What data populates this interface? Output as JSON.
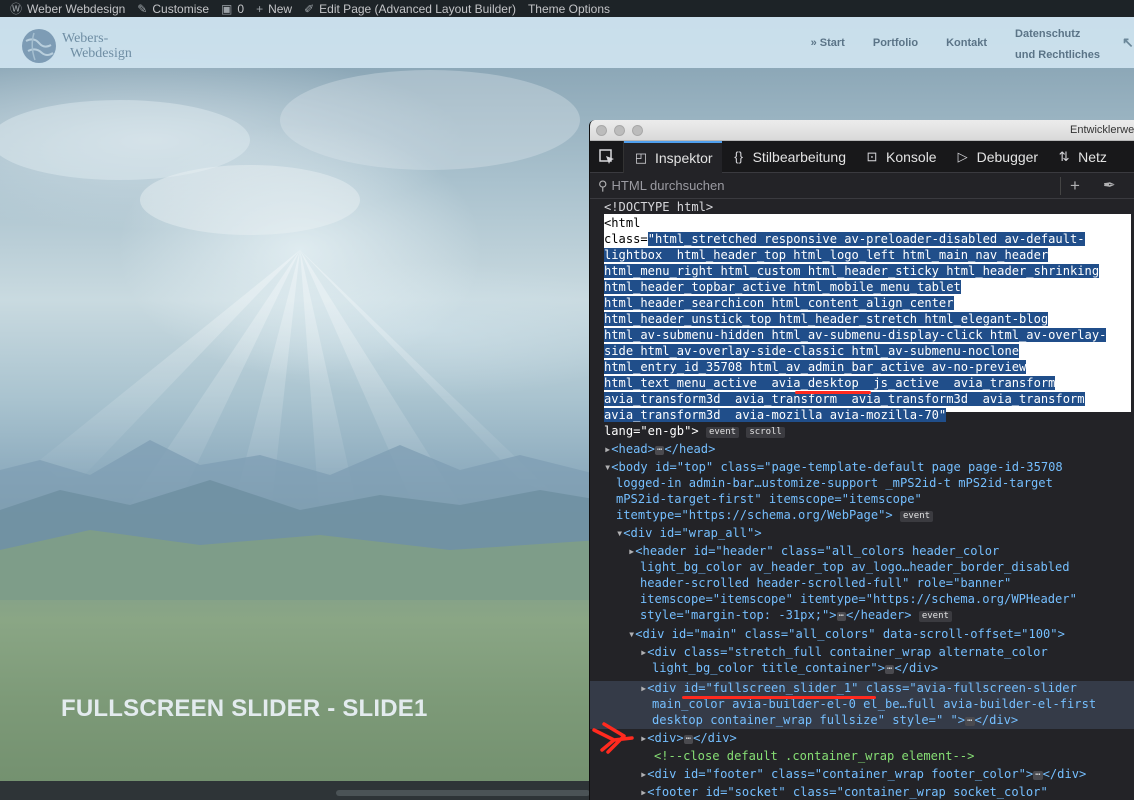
{
  "admin_bar": {
    "site_name": "Weber Webdesign",
    "customise": "Customise",
    "comments_count": "0",
    "new": "New",
    "edit_page": "Edit Page (Advanced Layout Builder)",
    "theme_options": "Theme Options",
    "icons": [
      "wordpress-icon",
      "home-icon",
      "brush-icon",
      "comment-icon",
      "plus-icon",
      "pencil-icon"
    ]
  },
  "site_header": {
    "logo_line1": "Webers-",
    "logo_line2": "Webdesign",
    "nav": {
      "start": "» Start",
      "portfolio": "Portfolio",
      "kontakt": "Kontakt",
      "datenschutz_line1": "Datenschutz",
      "datenschutz_line2": "und Rechtliches"
    }
  },
  "slide": {
    "caption": "FULLSCREEN SLIDER - SLIDE1"
  },
  "devtools": {
    "window_title": "Entwicklerwe",
    "tabs": {
      "inspector": "Inspektor",
      "style_editor": "Stilbearbeitung",
      "console": "Konsole",
      "debugger": "Debugger",
      "network": "Netz"
    },
    "search_placeholder": "HTML durchsuchen",
    "tree": {
      "doctype": "<!DOCTYPE html>",
      "html_open": "<html",
      "class_attr": "class=",
      "class_lines": [
        "\"html_stretched responsive av-preloader-disabled av-default-",
        "lightbox  html_header_top html_logo_left html_main_nav_header",
        "html_menu_right html_custom html_header_sticky html_header_shrinking",
        "html_header_topbar_active html_mobile_menu_tablet",
        "html_header_searchicon html_content_align_center",
        "html_header_unstick_top html_header_stretch html_elegant-blog",
        "html_av-submenu-hidden html_av-submenu-display-click html_av-overlay-",
        "side html_av-overlay-side-classic html_av-submenu-noclone",
        "html_entry_id_35708 html_av_admin_bar_active av-no-preview",
        "html_text_menu_active  avia_desktop  js_active  avia_transform",
        "avia_transform3d  avia_transform  avia_transform3d  avia_transform",
        "avia_transform3d  avia-mozilla avia-mozilla-70\""
      ],
      "lang_line": "lang=\"en-gb\">",
      "badge_event": "event",
      "badge_scroll": "scroll",
      "head": "<head>",
      "head_close": "</head>",
      "body_line1": "<body id=\"top\" class=\"page-template-default page page-id-35708",
      "body_line2": "logged-in admin-bar…ustomize-support _mPS2id-t mPS2id-target",
      "body_line3": "mPS2id-target-first\" itemscope=\"itemscope\"",
      "body_line4": "itemtype=\"https://schema.org/WebPage\">",
      "wrap_all": "<div id=\"wrap_all\">",
      "header_line1": "<header id=\"header\" class=\"all_colors header_color",
      "header_line2": "light_bg_color av_header_top av_logo…header_border_disabled",
      "header_line3": "header-scrolled header-scrolled-full\" role=\"banner\"",
      "header_line4": "itemscope=\"itemscope\" itemtype=\"https://schema.org/WPHeader\"",
      "header_line5": "style=\"margin-top: -31px;\">",
      "header_close": "</header>",
      "main_line": "<div id=\"main\" class=\"all_colors\" data-scroll-offset=\"100\">",
      "stretch_line1": "<div class=\"stretch_full container_wrap alternate_color",
      "stretch_line2": "light_bg_color title_container\">",
      "div_close": "</div>",
      "slider_line1": "<div id=\"fullscreen_slider_1\" class=\"avia-fullscreen-slider",
      "slider_line2": "main_color avia-builder-el-0 el_be…full avia-builder-el-first",
      "slider_line3": "desktop container_wrap fullsize\" style=\" \">",
      "plain_div": "<div>",
      "comment": "<!--close default .container_wrap element-->",
      "footer_line": "<div id=\"footer\" class=\"container_wrap footer_color\">",
      "socket_line": "<footer id=\"socket\" class=\"container_wrap socket_color\""
    }
  }
}
